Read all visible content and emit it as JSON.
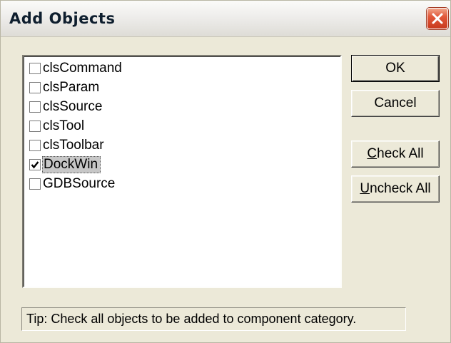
{
  "window": {
    "title": "Add Objects"
  },
  "objects": [
    {
      "label": "clsCommand",
      "checked": false
    },
    {
      "label": "clsParam",
      "checked": false
    },
    {
      "label": "clsSource",
      "checked": false
    },
    {
      "label": "clsTool",
      "checked": false
    },
    {
      "label": "clsToolbar",
      "checked": false
    },
    {
      "label": "DockWin",
      "checked": true,
      "selected": true
    },
    {
      "label": "GDBSource",
      "checked": false
    }
  ],
  "buttons": {
    "ok": "OK",
    "cancel": "Cancel",
    "check_all": {
      "mnemonic": "C",
      "rest": "heck All"
    },
    "uncheck_all": {
      "mnemonic": "U",
      "rest": "ncheck All"
    }
  },
  "tip": "Tip:  Check all objects to be added to component category.",
  "icons": {
    "close": "close-icon",
    "check": "checkmark-icon"
  },
  "colors": {
    "close_button": "#e2583a",
    "selection": "#c7c7c7",
    "dialog_bg": "#ece9d8"
  }
}
